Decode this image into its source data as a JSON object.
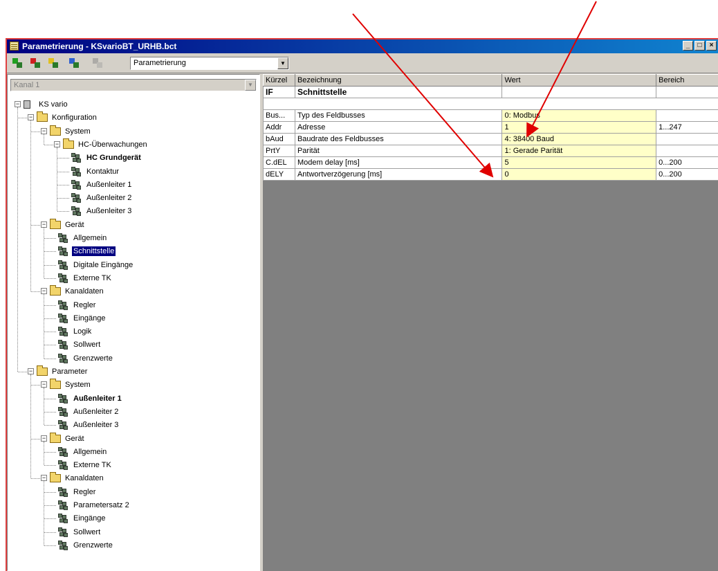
{
  "window": {
    "title": "Parametrierung - KSvarioBT_URHB.bct"
  },
  "toolbar": {
    "mode_value": "Parametrierung"
  },
  "channel_select": {
    "value": "Kanal 1"
  },
  "tree": [
    {
      "label": "KS vario",
      "level": 0,
      "type": "device",
      "exp": "-"
    },
    {
      "label": "Konfiguration",
      "level": 1,
      "type": "folder",
      "exp": "-"
    },
    {
      "label": "System",
      "level": 2,
      "type": "folder",
      "exp": "-"
    },
    {
      "label": "HC-Überwachungen",
      "level": 3,
      "type": "folder",
      "exp": "-"
    },
    {
      "label": "HC Grundgerät",
      "level": 4,
      "type": "leaf",
      "bold": true
    },
    {
      "label": "Kontaktur",
      "level": 4,
      "type": "leaf"
    },
    {
      "label": "Außenleiter 1",
      "level": 4,
      "type": "leaf"
    },
    {
      "label": "Außenleiter 2",
      "level": 4,
      "type": "leaf"
    },
    {
      "label": "Außenleiter 3",
      "level": 4,
      "type": "leaf"
    },
    {
      "label": "Gerät",
      "level": 2,
      "type": "folder",
      "exp": "-"
    },
    {
      "label": "Allgemein",
      "level": 3,
      "type": "leaf"
    },
    {
      "label": "Schnittstelle",
      "level": 3,
      "type": "leaf",
      "selected": true
    },
    {
      "label": "Digitale Eingänge",
      "level": 3,
      "type": "leaf"
    },
    {
      "label": "Externe TK",
      "level": 3,
      "type": "leaf"
    },
    {
      "label": "Kanaldaten",
      "level": 2,
      "type": "folder",
      "exp": "-"
    },
    {
      "label": "Regler",
      "level": 3,
      "type": "leaf"
    },
    {
      "label": "Eingänge",
      "level": 3,
      "type": "leaf"
    },
    {
      "label": "Logik",
      "level": 3,
      "type": "leaf"
    },
    {
      "label": "Sollwert",
      "level": 3,
      "type": "leaf"
    },
    {
      "label": "Grenzwerte",
      "level": 3,
      "type": "leaf"
    },
    {
      "label": "Parameter",
      "level": 1,
      "type": "folder",
      "exp": "-"
    },
    {
      "label": "System",
      "level": 2,
      "type": "folder",
      "exp": "-"
    },
    {
      "label": "Außenleiter 1",
      "level": 3,
      "type": "leaf",
      "bold": true
    },
    {
      "label": "Außenleiter 2",
      "level": 3,
      "type": "leaf"
    },
    {
      "label": "Außenleiter 3",
      "level": 3,
      "type": "leaf"
    },
    {
      "label": "Gerät",
      "level": 2,
      "type": "folder",
      "exp": "-"
    },
    {
      "label": "Allgemein",
      "level": 3,
      "type": "leaf"
    },
    {
      "label": "Externe TK",
      "level": 3,
      "type": "leaf"
    },
    {
      "label": "Kanaldaten",
      "level": 2,
      "type": "folder",
      "exp": "-"
    },
    {
      "label": "Regler",
      "level": 3,
      "type": "leaf"
    },
    {
      "label": "Parametersatz 2",
      "level": 3,
      "type": "leaf"
    },
    {
      "label": "Eingänge",
      "level": 3,
      "type": "leaf"
    },
    {
      "label": "Sollwert",
      "level": 3,
      "type": "leaf"
    },
    {
      "label": "Grenzwerte",
      "level": 3,
      "type": "leaf"
    }
  ],
  "grid": {
    "headers": [
      "Kürzel",
      "Bezeichnung",
      "Wert",
      "Bereich"
    ],
    "section": {
      "code": "IF",
      "name": "Schnittstelle"
    },
    "rows": [
      {
        "code": "Bus...",
        "name": "Typ des Feldbusses",
        "value": "0: Modbus",
        "range": ""
      },
      {
        "code": "Addr",
        "name": "Adresse",
        "value": "1",
        "range": "1...247"
      },
      {
        "code": "bAud",
        "name": "Baudrate des Feldbusses",
        "value": "4: 38400 Baud",
        "range": ""
      },
      {
        "code": "PrtY",
        "name": "Parität",
        "value": "1: Gerade Parität",
        "range": ""
      },
      {
        "code": "C.dEL",
        "name": "Modem delay [ms]",
        "value": "5",
        "range": "0...200"
      },
      {
        "code": "dELY",
        "name": "Antwortverzögerung [ms]",
        "value": "0",
        "range": "0...200"
      }
    ]
  },
  "colors": {
    "annotation_arrow": "#e00000",
    "value_cell": "#ffffc8",
    "selection": "#000080"
  }
}
